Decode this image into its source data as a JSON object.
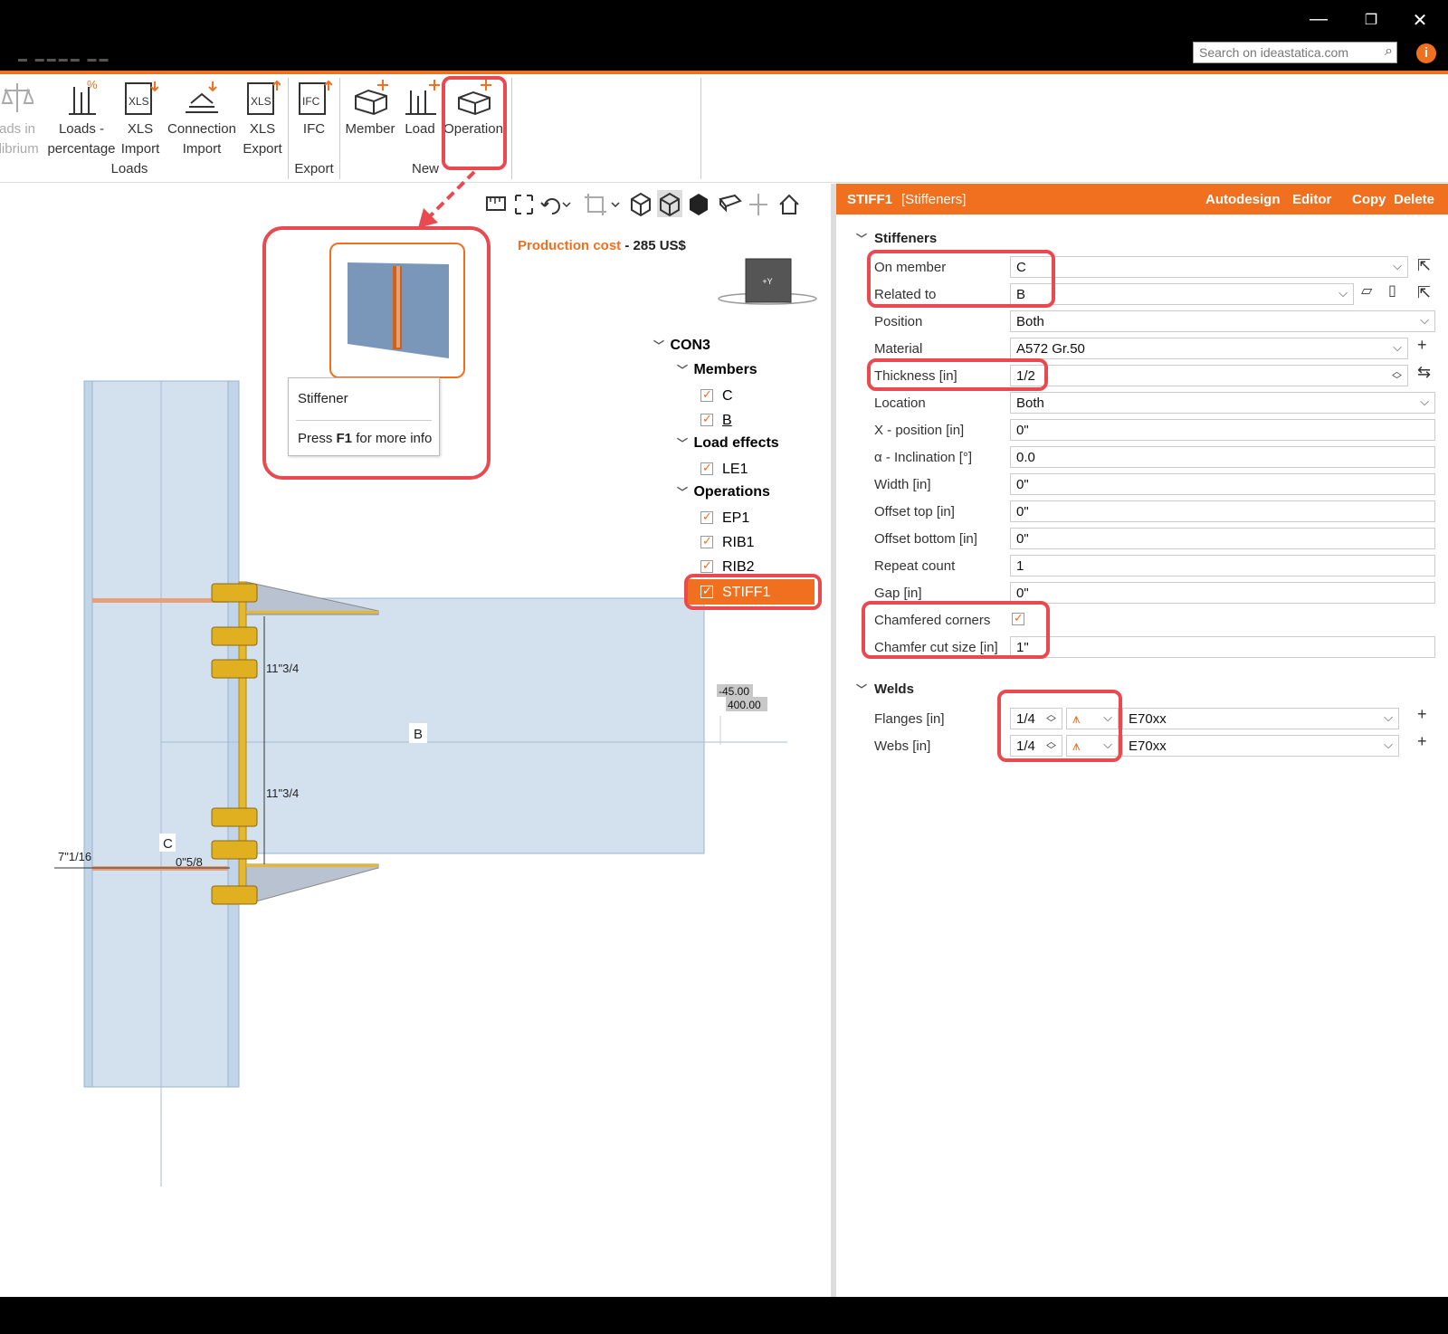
{
  "window": {
    "minimize_icon": "minimize-icon",
    "restore_icon": "restore-icon",
    "close_icon": "close-icon",
    "search_placeholder": "Search on ideastatica.com",
    "info_icon_label": "i"
  },
  "ribbon": {
    "buttons": {
      "loads_in_eq_1": "ads in",
      "loads_in_eq_2": "ilibrium",
      "loads_pct_1": "Loads -",
      "loads_pct_2": "percentage",
      "xls_import_1": "XLS",
      "xls_import_2": "Import",
      "conn_import_1": "Connection",
      "conn_import_2": "Import",
      "xls_export_1": "XLS",
      "xls_export_2": "Export",
      "ifc": "IFC",
      "member": "Member",
      "load": "Load",
      "operation": "Operation"
    },
    "groups": {
      "loads": "Loads",
      "export": "Export",
      "new": "New"
    }
  },
  "viewport": {
    "production_cost_label": "Production cost",
    "production_cost_sep": " - ",
    "production_cost_value": "285 US$",
    "nav_cube_label": "+Y",
    "dims": {
      "d1": "11\"3/4",
      "d2": "11\"3/4",
      "d3": "7\"1/16",
      "d4": "0\"5/8",
      "coord1": "-45.00",
      "coord2": "400.00"
    },
    "member_labels": {
      "b": "B",
      "c": "C"
    }
  },
  "tooltip": {
    "title": "Stiffener",
    "hint_pre": "Press ",
    "hint_key": "F1",
    "hint_post": " for more info"
  },
  "tree": {
    "root": "CON3",
    "members_label": "Members",
    "members": [
      "C",
      "B"
    ],
    "load_effects_label": "Load effects",
    "load_effects": [
      "LE1"
    ],
    "operations_label": "Operations",
    "operations": [
      "EP1",
      "RIB1",
      "RIB2",
      "STIFF1"
    ]
  },
  "panel": {
    "title": "STIFF1",
    "subtitle": "[Stiffeners]",
    "actions": {
      "autodesign": "Autodesign",
      "editor": "Editor",
      "copy": "Copy",
      "delete": "Delete"
    },
    "stiffeners_section": "Stiffeners",
    "props": {
      "on_member": {
        "label": "On member",
        "value": "C"
      },
      "related_to": {
        "label": "Related to",
        "value": "B"
      },
      "position": {
        "label": "Position",
        "value": "Both"
      },
      "material": {
        "label": "Material",
        "value": "A572 Gr.50"
      },
      "thickness": {
        "label": "Thickness [in]",
        "value": "1/2"
      },
      "location": {
        "label": "Location",
        "value": "Both"
      },
      "x_position": {
        "label": "X - position [in]",
        "value": "0\""
      },
      "inclination": {
        "label": "α - Inclination [°]",
        "value": "0.0"
      },
      "width": {
        "label": "Width [in]",
        "value": "0\""
      },
      "offset_top": {
        "label": "Offset top [in]",
        "value": "0\""
      },
      "offset_bottom": {
        "label": "Offset bottom [in]",
        "value": "0\""
      },
      "repeat_count": {
        "label": "Repeat count",
        "value": "1"
      },
      "gap": {
        "label": "Gap [in]",
        "value": "0\""
      },
      "chamfered_corners": {
        "label": "Chamfered corners",
        "checked": true
      },
      "chamfer_cut_size": {
        "label": "Chamfer cut size [in]",
        "value": "1\""
      }
    },
    "welds_section": "Welds",
    "welds": {
      "flanges": {
        "label": "Flanges [in]",
        "size": "1/4",
        "material": "E70xx"
      },
      "webs": {
        "label": "Webs [in]",
        "size": "1/4",
        "material": "E70xx"
      }
    }
  },
  "colors": {
    "accent": "#f07020",
    "highlight": "#e84a50",
    "member_fill": "#d3e0ee",
    "bolt": "#e0b020"
  }
}
